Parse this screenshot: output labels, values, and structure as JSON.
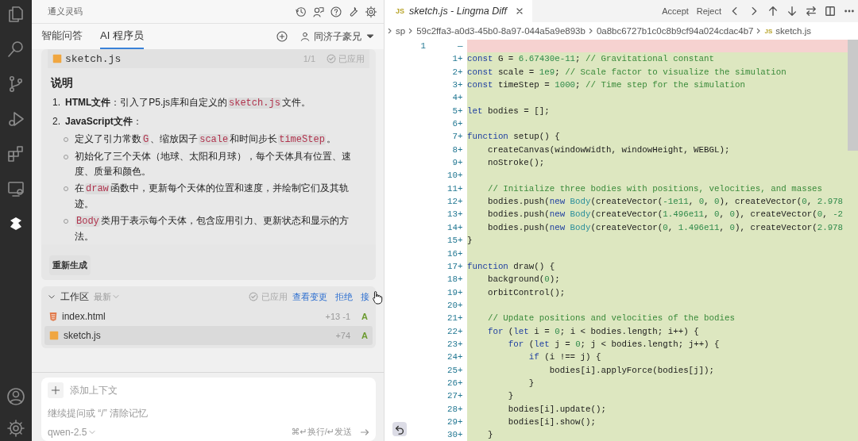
{
  "activity_bar": [
    {
      "selected": false
    },
    {
      "selected": false
    },
    {
      "selected": false
    },
    {
      "selected": false
    },
    {
      "selected": false
    },
    {
      "selected": false
    },
    {
      "selected": true
    },
    {
      "selected": false
    },
    {
      "selected": false
    }
  ],
  "panel": {
    "title": "通义灵码",
    "tabs": [
      {
        "label": "智能问答",
        "selected": false
      },
      {
        "label": "AI 程序员",
        "selected": true
      }
    ],
    "user": "同济子豪兄",
    "answer": {
      "file": {
        "name": "sketch.js",
        "count": "1/1",
        "status": "已应用"
      },
      "heading": "说明",
      "items": [
        {
          "number": "1.",
          "segments": [
            {
              "kind": "bold",
              "text": "HTML文件"
            },
            {
              "kind": "text",
              "text": "：引入了P5.js库和自定义的"
            },
            {
              "kind": "code",
              "text": "sketch.js"
            },
            {
              "kind": "text",
              "text": "文件。"
            }
          ]
        },
        {
          "number": "2.",
          "segments": [
            {
              "kind": "bold",
              "text": "JavaScript文件"
            },
            {
              "kind": "text",
              "text": "："
            }
          ],
          "children": [
            {
              "segments": [
                {
                  "kind": "text",
                  "text": "定义了引力常数"
                },
                {
                  "kind": "code",
                  "text": "G"
                },
                {
                  "kind": "text",
                  "text": "、缩放因子"
                },
                {
                  "kind": "code",
                  "text": "scale"
                },
                {
                  "kind": "text",
                  "text": "和时间步长"
                },
                {
                  "kind": "code",
                  "text": "timeStep"
                },
                {
                  "kind": "text",
                  "text": "。"
                }
              ]
            },
            {
              "segments": [
                {
                  "kind": "text",
                  "text": "初始化了三个天体（地球、太阳和月球），每个天体具有位置、速度、质量和颜色。"
                }
              ]
            },
            {
              "segments": [
                {
                  "kind": "text",
                  "text": "在"
                },
                {
                  "kind": "code",
                  "text": "draw"
                },
                {
                  "kind": "text",
                  "text": "函数中，更新每个天体的位置和速度，并绘制它们及其轨迹。"
                }
              ]
            },
            {
              "segments": [
                {
                  "kind": "code",
                  "text": "Body"
                },
                {
                  "kind": "text",
                  "text": "类用于表示每个天体，包含应用引力、更新状态和显示的方法。"
                }
              ]
            }
          ]
        }
      ],
      "regenerate": "重新生成"
    },
    "workspace": {
      "title": "工作区",
      "filter": "最新",
      "status": "已应用",
      "actions": [
        "查看变更",
        "拒绝",
        "接"
      ],
      "files": [
        {
          "name": "index.html",
          "kind": "html",
          "stats": "+13 -1",
          "status": "A",
          "selected": false
        },
        {
          "name": "sketch.js",
          "kind": "js",
          "stats": "+74",
          "status": "A",
          "selected": true
        }
      ]
    },
    "input": {
      "add_context": "添加上下文",
      "placeholder": "继续提问或 “/” 清除记忆",
      "model": "qwen-2.5",
      "hint": "⌘↵换行/↵发送"
    }
  },
  "editor": {
    "tab": {
      "badge": "JS",
      "label": "sketch.js - Lingma Diff"
    },
    "actions": [
      "Accept",
      "Reject"
    ],
    "breadcrumbs": [
      "sp",
      "59c2ffa3-a0d3-45b0-8a97-044a5a9e893b",
      "0a8bc6727b1c0c8b9cf94a024cdac4b7",
      "sketch.js"
    ],
    "breadcrumb_badge": "JS",
    "lines": [
      {
        "kind": "removed",
        "old": "1",
        "sign": "—"
      },
      {
        "kind": "added",
        "new": "1",
        "sign": "+",
        "text": "const G = 6.67430e-11; // Gravitational constant"
      },
      {
        "kind": "added",
        "new": "2",
        "sign": "+",
        "text": "const scale = 1e9; // Scale factor to visualize the simulation"
      },
      {
        "kind": "added",
        "new": "3",
        "sign": "+",
        "text": "const timeStep = 1000; // Time step for the simulation"
      },
      {
        "kind": "added",
        "new": "4",
        "sign": "+"
      },
      {
        "kind": "added",
        "new": "5",
        "sign": "+",
        "text": "let bodies = [];"
      },
      {
        "kind": "added",
        "new": "6",
        "sign": "+"
      },
      {
        "kind": "added",
        "new": "7",
        "sign": "+",
        "text": "function setup() {"
      },
      {
        "kind": "added",
        "new": "8",
        "sign": "+",
        "text": "    createCanvas(windowWidth, windowHeight, WEBGL);"
      },
      {
        "kind": "added",
        "new": "9",
        "sign": "+",
        "text": "    noStroke();"
      },
      {
        "kind": "added",
        "new": "10",
        "sign": "+"
      },
      {
        "kind": "added",
        "new": "11",
        "sign": "+",
        "text": "    // Initialize three bodies with positions, velocities, and masses"
      },
      {
        "kind": "added",
        "new": "12",
        "sign": "+",
        "text": "    bodies.push(new Body(createVector(-1e11, 0, 0), createVector(0, 2.978"
      },
      {
        "kind": "added",
        "new": "13",
        "sign": "+",
        "text": "    bodies.push(new Body(createVector(1.496e11, 0, 0), createVector(0, -2"
      },
      {
        "kind": "added",
        "new": "14",
        "sign": "+",
        "text": "    bodies.push(new Body(createVector(0, 1.496e11, 0), createVector(2.978"
      },
      {
        "kind": "added",
        "new": "15",
        "sign": "+",
        "text": "}"
      },
      {
        "kind": "added",
        "new": "16",
        "sign": "+"
      },
      {
        "kind": "added",
        "new": "17",
        "sign": "+",
        "text": "function draw() {"
      },
      {
        "kind": "added",
        "new": "18",
        "sign": "+",
        "text": "    background(0);"
      },
      {
        "kind": "added",
        "new": "19",
        "sign": "+",
        "text": "    orbitControl();"
      },
      {
        "kind": "added",
        "new": "20",
        "sign": "+"
      },
      {
        "kind": "added",
        "new": "21",
        "sign": "+",
        "text": "    // Update positions and velocities of the bodies"
      },
      {
        "kind": "added",
        "new": "22",
        "sign": "+",
        "text": "    for (let i = 0; i < bodies.length; i++) {"
      },
      {
        "kind": "added",
        "new": "23",
        "sign": "+",
        "text": "        for (let j = 0; j < bodies.length; j++) {"
      },
      {
        "kind": "added",
        "new": "24",
        "sign": "+",
        "text": "            if (i !== j) {"
      },
      {
        "kind": "added",
        "new": "25",
        "sign": "+",
        "text": "                bodies[i].applyForce(bodies[j]);"
      },
      {
        "kind": "added",
        "new": "26",
        "sign": "+",
        "text": "            }"
      },
      {
        "kind": "added",
        "new": "27",
        "sign": "+",
        "text": "        }"
      },
      {
        "kind": "added",
        "new": "28",
        "sign": "+",
        "text": "        bodies[i].update();"
      },
      {
        "kind": "added",
        "new": "29",
        "sign": "+",
        "text": "        bodies[i].show();"
      },
      {
        "kind": "added",
        "new": "30",
        "sign": "+",
        "text": "    }"
      }
    ]
  }
}
